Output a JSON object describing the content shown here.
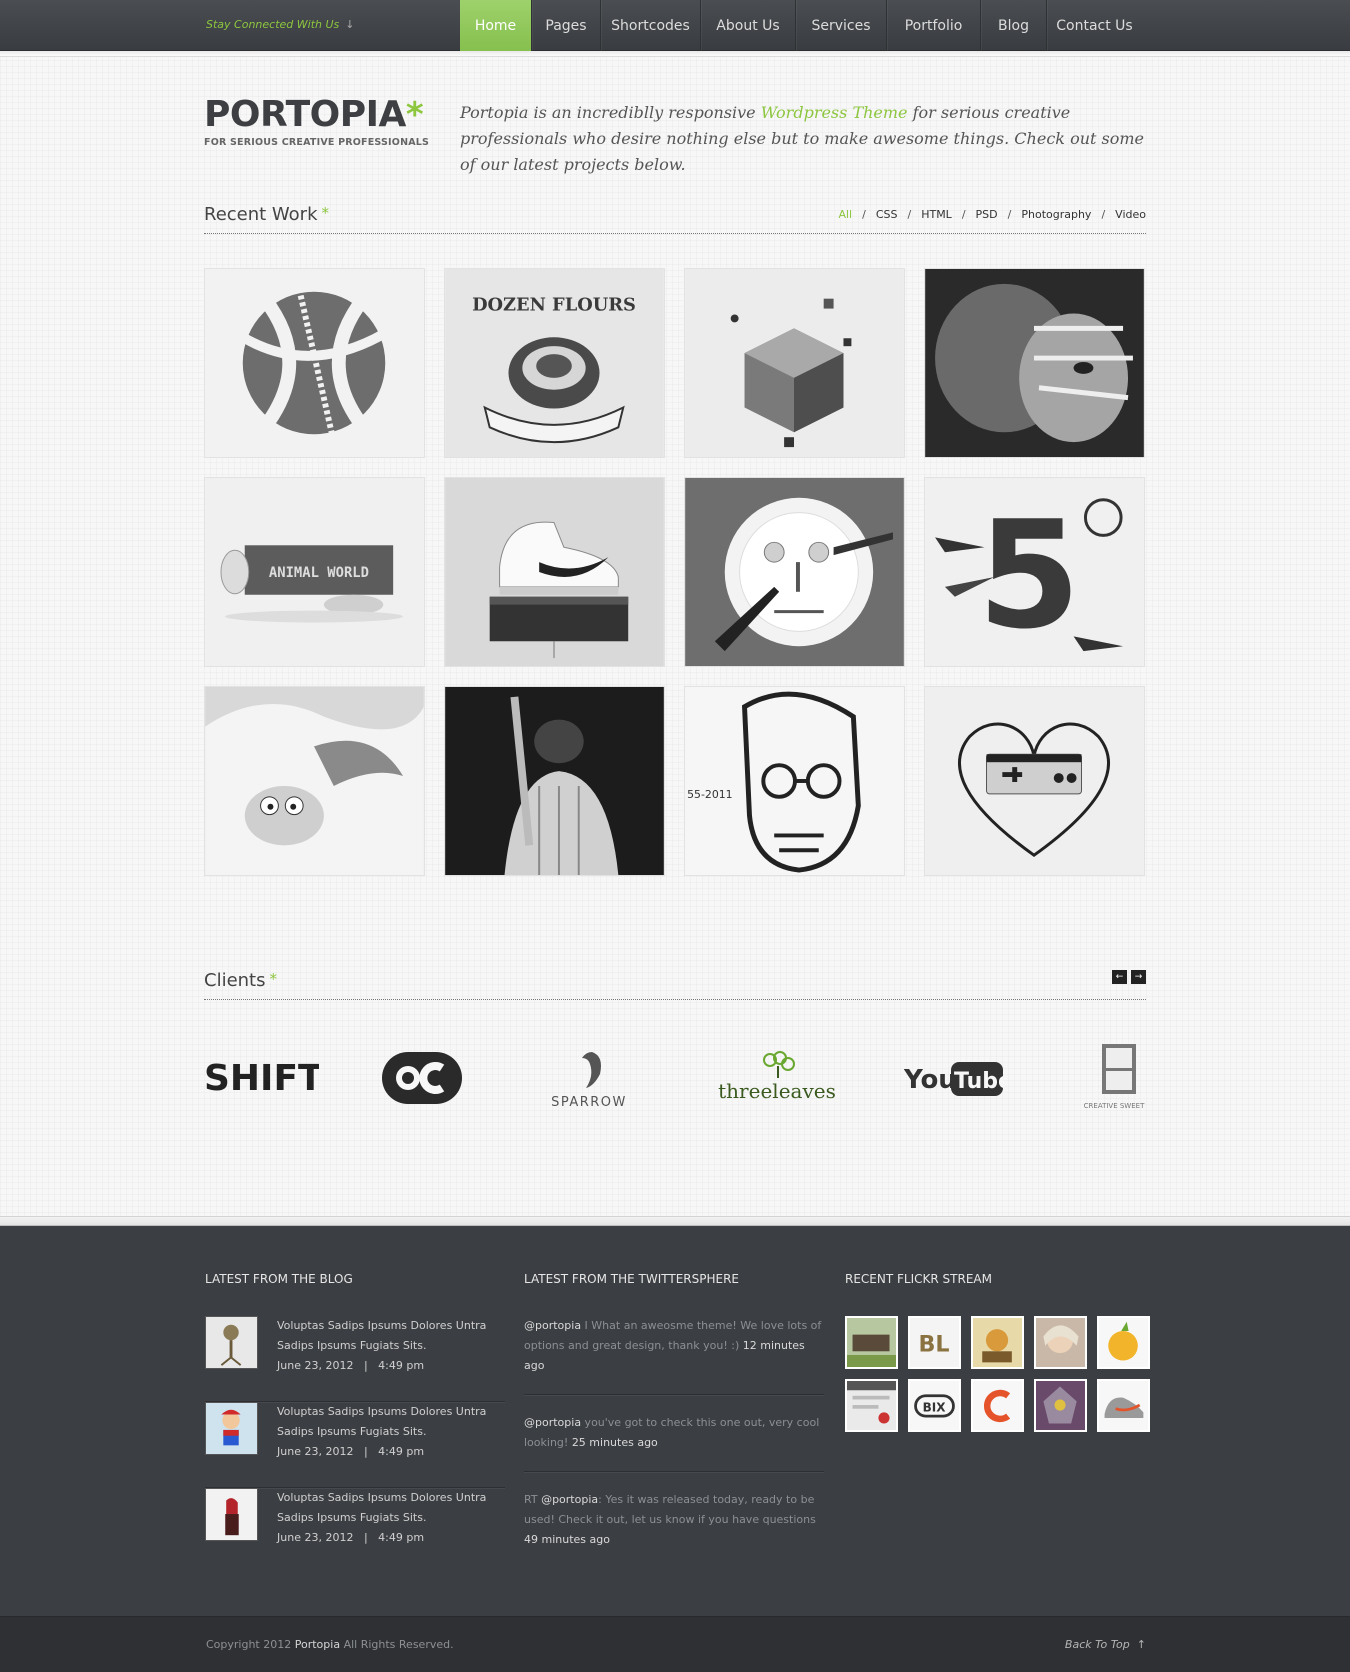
{
  "topbar": {
    "stay_connected": "Stay Connected With Us",
    "stay_arrow": "↓",
    "nav": [
      {
        "label": "Home",
        "active": true
      },
      {
        "label": "Pages"
      },
      {
        "label": "Shortcodes"
      },
      {
        "label": "About Us"
      },
      {
        "label": "Services"
      },
      {
        "label": "Portfolio"
      },
      {
        "label": "Blog"
      },
      {
        "label": "Contact Us"
      }
    ]
  },
  "header": {
    "logo_word": "PORTOPIA",
    "logo_mark": "*",
    "logo_tagline": "FOR SERIOUS CREATIVE PROFESSIONALS",
    "intro_before": "Portopia is an incrediblly responsive ",
    "intro_highlight": "Wordpress Theme",
    "intro_after": " for serious creative professionals who desire nothing else but to make awesome things. Check out some of our latest projects below."
  },
  "recent_work": {
    "title": "Recent Work",
    "mark": "*",
    "filters": [
      "All",
      "CSS",
      "HTML",
      "PSD",
      "Photography",
      "Video"
    ],
    "active_filter": "All",
    "items": [
      {
        "subject": "basketball-artwork"
      },
      {
        "subject": "dozen-flours-logo",
        "text": "DOZEN FLOURS"
      },
      {
        "subject": "exploding-cube"
      },
      {
        "subject": "football-player"
      },
      {
        "subject": "animal-world-sign",
        "text": "ANIMAL WORLD"
      },
      {
        "subject": "sneaker-on-box"
      },
      {
        "subject": "plate-face"
      },
      {
        "subject": "number-five-shatter"
      },
      {
        "subject": "milk-splash-creature"
      },
      {
        "subject": "baseball-player"
      },
      {
        "subject": "portrait-illustration",
        "text": "55-2011"
      },
      {
        "subject": "controller-heart"
      }
    ]
  },
  "clients": {
    "title": "Clients",
    "mark": "*",
    "prev": "←",
    "next": "→",
    "logos": [
      {
        "name": "SHIFT"
      },
      {
        "name": "OC"
      },
      {
        "name": "SPARROW"
      },
      {
        "name": "threeleaves"
      },
      {
        "name": "YouTube",
        "part1": "You",
        "part2": "Tube"
      },
      {
        "name": "CREATIVE SWEET"
      }
    ]
  },
  "footer": {
    "blog": {
      "title": "LATEST FROM THE BLOG",
      "items": [
        {
          "text": "Voluptas Sadips Ipsums Dolores Untra Sadips Ipsums Fugiats Sits.",
          "date": "June 23, 2012",
          "time": "4:49 pm",
          "sep": "|"
        },
        {
          "text": "Voluptas Sadips Ipsums Dolores Untra Sadips Ipsums Fugiats Sits.",
          "date": "June 23, 2012",
          "time": "4:49 pm",
          "sep": "|"
        },
        {
          "text": "Voluptas Sadips Ipsums Dolores Untra Sadips Ipsums Fugiats Sits.",
          "date": "June 23, 2012",
          "time": "4:49 pm",
          "sep": "|"
        }
      ]
    },
    "twitter": {
      "title": "LATEST FROM THE TWITTERSPHERE",
      "tweets": [
        {
          "prefix": "",
          "user": "@portopia",
          "text": " I What an aweosme theme!  We love lots of options and great design, thank you!  :) ",
          "time": "12 minutes ago"
        },
        {
          "prefix": "",
          "user": "@portopia",
          "text": " you've got to check this one out, very cool looking! ",
          "time": "25 minutes ago"
        },
        {
          "prefix": "RT ",
          "user": "@portopia",
          "text": ": Yes it was released today, ready to be used! Check it out, let us know if you have questions ",
          "time": "49 minutes ago"
        }
      ]
    },
    "flickr": {
      "title": "RECENT FLICKR STREAM",
      "items": [
        {
          "subject": "animal-world"
        },
        {
          "subject": "bl-letters",
          "text": "BL"
        },
        {
          "subject": "illustration"
        },
        {
          "subject": "portrait"
        },
        {
          "subject": "citrus"
        },
        {
          "subject": "web-layout"
        },
        {
          "subject": "bix-logo",
          "text": "BIX"
        },
        {
          "subject": "c-logo"
        },
        {
          "subject": "robot"
        },
        {
          "subject": "nike-shoe"
        }
      ]
    }
  },
  "bottombar": {
    "copyright_before": "Copyright 2012 ",
    "copyright_brand": "Portopia",
    "copyright_after": "  All Rights Reserved.",
    "back_to_top": "Back To Top",
    "back_arrow": "↑"
  },
  "colors": {
    "accent": "#8dc63f",
    "nav_bg": "#3f4246",
    "footer_bg": "#3b3e42",
    "bottom_bg": "#2e3033"
  }
}
